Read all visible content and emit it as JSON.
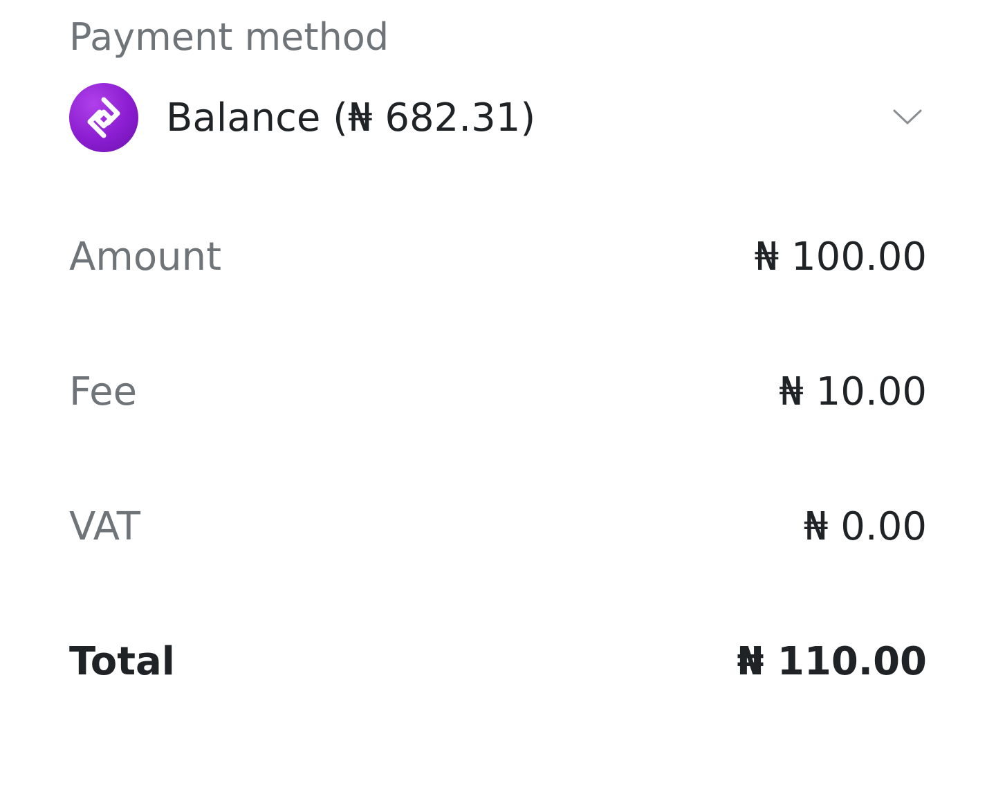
{
  "payment_method": {
    "label": "Payment method",
    "selected": "Balance (₦ 682.31)",
    "icon": "wallet-brand-logo-icon",
    "dropdown_icon": "chevron-down-icon",
    "accent_color": "#8a1dd0"
  },
  "summary": {
    "amount": {
      "label": "Amount",
      "value": "₦ 100.00"
    },
    "fee": {
      "label": "Fee",
      "value": "₦ 10.00"
    },
    "vat": {
      "label": "VAT",
      "value": "₦ 0.00"
    },
    "total": {
      "label": "Total",
      "value": "₦ 110.00"
    }
  }
}
